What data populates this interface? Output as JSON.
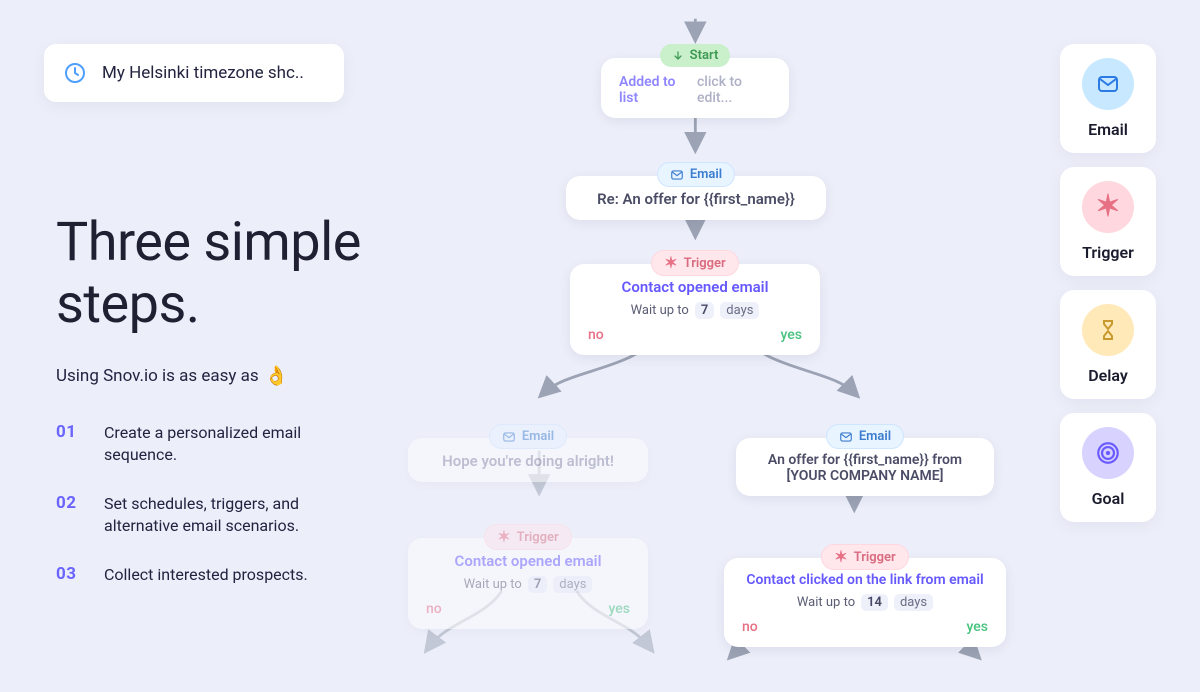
{
  "timezone": {
    "icon": "clock-icon",
    "text": "My Helsinki timezone shc.."
  },
  "headline": {
    "line1": "Three simple",
    "line2": "steps."
  },
  "subline": {
    "text": "Using Snov.io is as easy as",
    "emoji": "👌"
  },
  "steps": [
    {
      "num": "01",
      "text": "Create a personalized email sequence."
    },
    {
      "num": "02",
      "text": "Set schedules, triggers, and alternative email scenarios."
    },
    {
      "num": "03",
      "text": "Collect interested prospects."
    }
  ],
  "toolbar": [
    {
      "key": "email",
      "label": "Email"
    },
    {
      "key": "trigger",
      "label": "Trigger"
    },
    {
      "key": "delay",
      "label": "Delay"
    },
    {
      "key": "goal",
      "label": "Goal"
    }
  ],
  "flow": {
    "start": {
      "badge": "Start",
      "left": "Added to list",
      "right": "click to edit..."
    },
    "email1": {
      "badge": "Email",
      "subject": "Re: An offer for {{first_name}}"
    },
    "trigger1": {
      "badge": "Trigger",
      "title": "Contact opened email",
      "wait_prefix": "Wait up to",
      "wait_num": "7",
      "wait_unit": "days",
      "no": "no",
      "yes": "yes"
    },
    "emailL": {
      "badge": "Email",
      "subject": "Hope you're doing alright!"
    },
    "emailR": {
      "badge": "Email",
      "subject": "An offer for {{first_name}} from [YOUR COMPANY NAME]"
    },
    "triggerL": {
      "badge": "Trigger",
      "title": "Contact opened email",
      "wait_prefix": "Wait up to",
      "wait_num": "7",
      "wait_unit": "days",
      "no": "no",
      "yes": "yes"
    },
    "triggerR": {
      "badge": "Trigger",
      "title": "Contact clicked on the link from email",
      "wait_prefix": "Wait up to",
      "wait_num": "14",
      "wait_unit": "days",
      "no": "no",
      "yes": "yes"
    }
  }
}
